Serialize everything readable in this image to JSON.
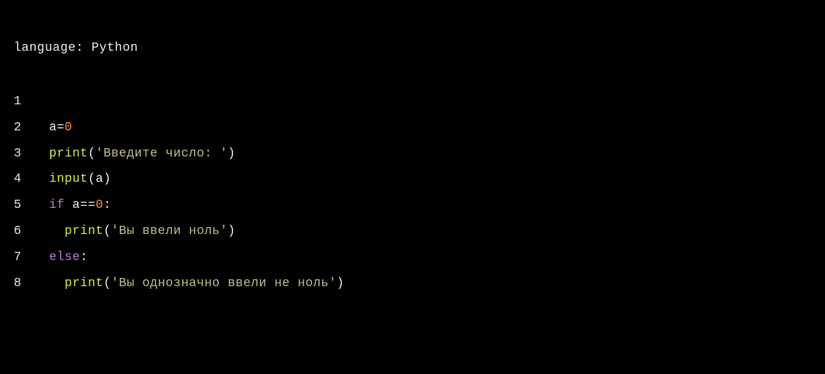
{
  "header": {
    "language_label": "language: ",
    "language_value": "Python"
  },
  "code": {
    "lines": [
      {
        "num": "1",
        "tokens": []
      },
      {
        "num": "2",
        "tokens": [
          {
            "t": "a=",
            "c": "tok-default"
          },
          {
            "t": "0",
            "c": "tok-number"
          }
        ]
      },
      {
        "num": "3",
        "tokens": [
          {
            "t": "print",
            "c": "tok-builtin"
          },
          {
            "t": "(",
            "c": "tok-default"
          },
          {
            "t": "'Введите число: '",
            "c": "tok-string"
          },
          {
            "t": ")",
            "c": "tok-default"
          }
        ]
      },
      {
        "num": "4",
        "tokens": [
          {
            "t": "input",
            "c": "tok-builtin"
          },
          {
            "t": "(a)",
            "c": "tok-default"
          }
        ]
      },
      {
        "num": "5",
        "tokens": [
          {
            "t": "if",
            "c": "tok-keyword"
          },
          {
            "t": " a==",
            "c": "tok-default"
          },
          {
            "t": "0",
            "c": "tok-number"
          },
          {
            "t": ":",
            "c": "tok-default"
          }
        ]
      },
      {
        "num": "6",
        "tokens": [
          {
            "t": "  ",
            "c": "tok-default"
          },
          {
            "t": "print",
            "c": "tok-builtin"
          },
          {
            "t": "(",
            "c": "tok-default"
          },
          {
            "t": "'Вы ввели ноль'",
            "c": "tok-string"
          },
          {
            "t": ")",
            "c": "tok-default"
          }
        ]
      },
      {
        "num": "7",
        "tokens": [
          {
            "t": "else",
            "c": "tok-keyword"
          },
          {
            "t": ":",
            "c": "tok-default"
          }
        ]
      },
      {
        "num": "8",
        "tokens": [
          {
            "t": "  ",
            "c": "tok-default"
          },
          {
            "t": "print",
            "c": "tok-builtin"
          },
          {
            "t": "(",
            "c": "tok-default"
          },
          {
            "t": "'Вы однозначно ввели не ноль'",
            "c": "tok-string"
          },
          {
            "t": ")",
            "c": "tok-default"
          }
        ]
      }
    ]
  }
}
